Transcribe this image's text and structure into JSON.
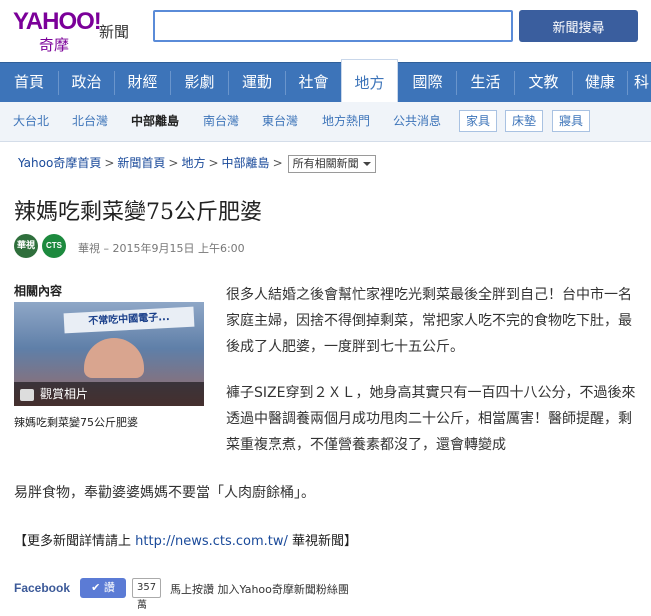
{
  "header": {
    "logo_yahoo": "YAHOO!",
    "logo_sub": "奇摩",
    "logo_section": "新聞",
    "search_value": "",
    "search_button": "新聞搜尋"
  },
  "nav": {
    "items": [
      "首頁",
      "政治",
      "財經",
      "影劇",
      "運動",
      "社會",
      "地方",
      "國際",
      "生活",
      "文教",
      "健康",
      "科"
    ]
  },
  "subnav": {
    "items": [
      "大台北",
      "北台灣",
      "中部離島",
      "南台灣",
      "東台灣",
      "地方熱門",
      "公共消息"
    ],
    "boxes": [
      "家具",
      "床墊",
      "寢具"
    ]
  },
  "breadcrumb": {
    "items": [
      "Yahoo奇摩首頁",
      "新聞首頁",
      "地方",
      "中部離島"
    ],
    "select": "所有相關新聞"
  },
  "article": {
    "title": "辣媽吃剩菜變75公斤肥婆",
    "source_logo1": "華視",
    "source_logo2": "CTS",
    "meta": "華視 – 2015年9月15日 上午6:00",
    "related_title": "相關內容",
    "thumb_banner": "不常吃中國電子...",
    "thumb_label": "觀賞相片",
    "thumb_caption": "辣媽吃剩菜變75公斤肥婆",
    "p1": "很多人結婚之後會幫忙家裡吃光剩菜最後全胖到自己！台中市一名家庭主婦，因捨不得倒掉剩菜，常把家人吃不完的食物吃下肚，最後成了人肥婆，一度胖到七十五公斤。",
    "p2a": "褲子SIZE穿到２ＸＬ，她身高其實只有一百四十八公分，不過後來透過中醫調養兩個月成功甩肉二十公斤，相當厲害！醫師提醒，剩菜重複烹煮，不僅營養素都沒了，還會轉變成",
    "p2b": "易胖食物，奉勸婆婆媽媽不要當「人肉廚餘桶」。",
    "footer_prefix": "【更多新聞詳情請上 ",
    "footer_url": "http://news.cts.com.tw/",
    "footer_suffix": " 華視新聞】"
  },
  "social": {
    "fb_label": "Facebook",
    "like_button": "讚",
    "like_count": "357萬",
    "like_text": "馬上按讚 加入Yahoo奇摩新聞粉絲團"
  },
  "colors": {
    "nav_bg": "#3d74b9",
    "brand_purple": "#7b0099",
    "search_btn": "#3a5e9e",
    "link": "#1a4a9a"
  }
}
